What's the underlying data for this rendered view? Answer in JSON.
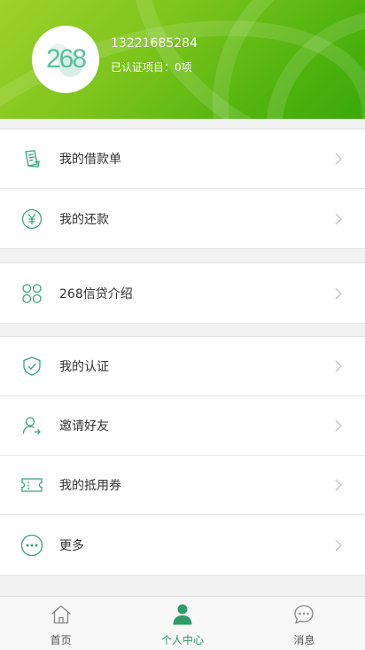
{
  "header": {
    "avatar_text": "268",
    "phone": "13221685284",
    "cert_status": "已认证项目：0项"
  },
  "menu": {
    "group1": [
      {
        "label": "我的借款单",
        "icon": "document-icon"
      },
      {
        "label": "我的还款",
        "icon": "yuan-circle-icon"
      }
    ],
    "group2": [
      {
        "label": "268信贷介绍",
        "icon": "grid-icon"
      }
    ],
    "group3": [
      {
        "label": "我的认证",
        "icon": "shield-check-icon"
      },
      {
        "label": "邀请好友",
        "icon": "user-invite-icon"
      },
      {
        "label": "我的抵用券",
        "icon": "ticket-icon"
      },
      {
        "label": "更多",
        "icon": "more-dots-icon"
      }
    ]
  },
  "tabbar": {
    "tabs": [
      {
        "label": "首页",
        "icon": "home-icon",
        "active": false
      },
      {
        "label": "个人中心",
        "icon": "person-icon",
        "active": true
      },
      {
        "label": "消息",
        "icon": "message-icon",
        "active": false
      }
    ]
  },
  "colors": {
    "accent": "#2e9b68",
    "icon_green": "#3aa57a",
    "header_green": "#6cbf1a"
  }
}
